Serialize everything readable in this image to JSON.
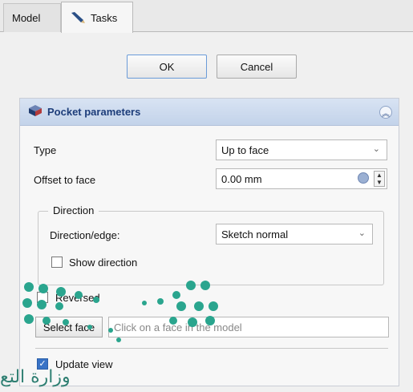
{
  "tabs": [
    {
      "label": "Model"
    },
    {
      "label": "Tasks"
    }
  ],
  "dialog_buttons": {
    "ok": "OK",
    "cancel": "Cancel"
  },
  "panel": {
    "title": "Pocket parameters",
    "type_label": "Type",
    "type_value": "Up to face",
    "offset_label": "Offset to face",
    "offset_value": "0.00 mm",
    "direction": {
      "group_title": "Direction",
      "edge_label": "Direction/edge:",
      "edge_value": "Sketch normal",
      "show_direction_label": "Show direction",
      "show_direction_checked": false
    },
    "reversed_label": "Reversed",
    "reversed_checked": false,
    "select_face_label": "Select face",
    "face_placeholder": "Click on a face in the model",
    "update_view_label": "Update view",
    "update_view_checked": true
  },
  "watermark": {
    "text": "وزارة التع"
  },
  "colors": {
    "accent": "#3973c6",
    "panel_header": "#c3d3ea",
    "title": "#1d3d7a",
    "watermark": "#2f7f72"
  },
  "icons": [
    "pencil-icon",
    "pocket-icon",
    "collapse-icon",
    "reset-icon",
    "spin-arrows-icon",
    "dropdown-arrow-icon",
    "check-icon"
  ]
}
